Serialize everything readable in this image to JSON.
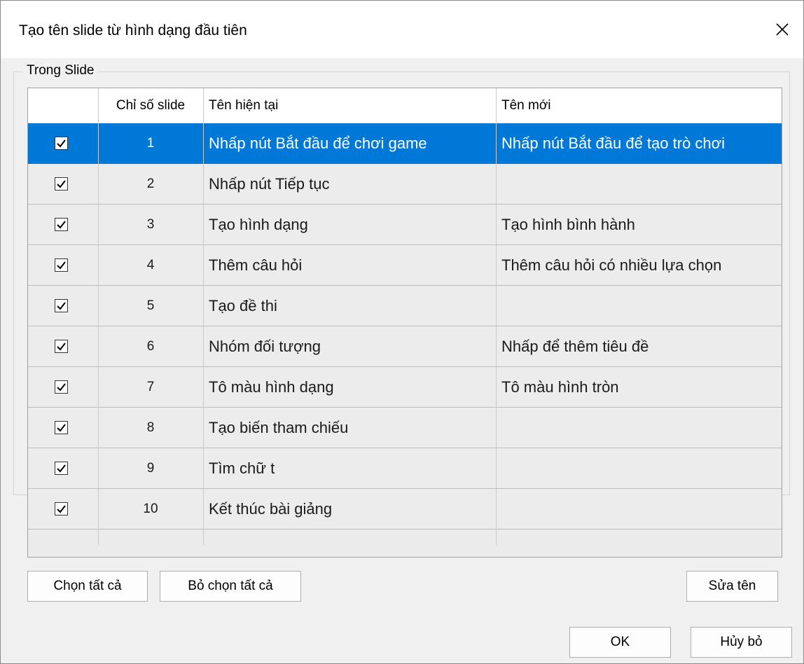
{
  "window": {
    "title": "Tạo tên slide từ hình dạng đầu tiên",
    "close_icon": "close-icon"
  },
  "group": {
    "label": "Trong Slide"
  },
  "table": {
    "headers": {
      "check": "",
      "index": "Chỉ số slide",
      "current": "Tên hiện tại",
      "new": "Tên mới"
    },
    "selected_row": 0,
    "rows": [
      {
        "checked": true,
        "index": "1",
        "current": "Nhấp nút Bắt đầu để chơi game",
        "new": "Nhấp nút Bắt đầu để tạo trò chơi"
      },
      {
        "checked": true,
        "index": "2",
        "current": "Nhấp nút Tiếp tục",
        "new": ""
      },
      {
        "checked": true,
        "index": "3",
        "current": "Tạo hình dạng",
        "new": "Tạo hình bình hành"
      },
      {
        "checked": true,
        "index": "4",
        "current": "Thêm câu hỏi",
        "new": "Thêm câu hỏi có nhiều lựa chọn"
      },
      {
        "checked": true,
        "index": "5",
        "current": "Tạo đề thi",
        "new": ""
      },
      {
        "checked": true,
        "index": "6",
        "current": "Nhóm đối tượng",
        "new": "Nhấp để thêm tiêu đề"
      },
      {
        "checked": true,
        "index": "7",
        "current": "Tô màu hình dạng",
        "new": "Tô màu hình tròn"
      },
      {
        "checked": true,
        "index": "8",
        "current": "Tạo biến tham chiếu",
        "new": ""
      },
      {
        "checked": true,
        "index": "9",
        "current": "Tìm chữ t",
        "new": ""
      },
      {
        "checked": true,
        "index": "10",
        "current": "Kết thúc bài giảng",
        "new": ""
      }
    ]
  },
  "buttons": {
    "select_all": "Chọn tất cả",
    "deselect_all": "Bỏ chọn tất cả",
    "rename": "Sửa tên",
    "ok": "OK",
    "cancel": "Hủy bỏ"
  },
  "colors": {
    "selection": "#0078d7",
    "row_bg": "#ececec",
    "dialog_bg": "#f0f0f0"
  }
}
